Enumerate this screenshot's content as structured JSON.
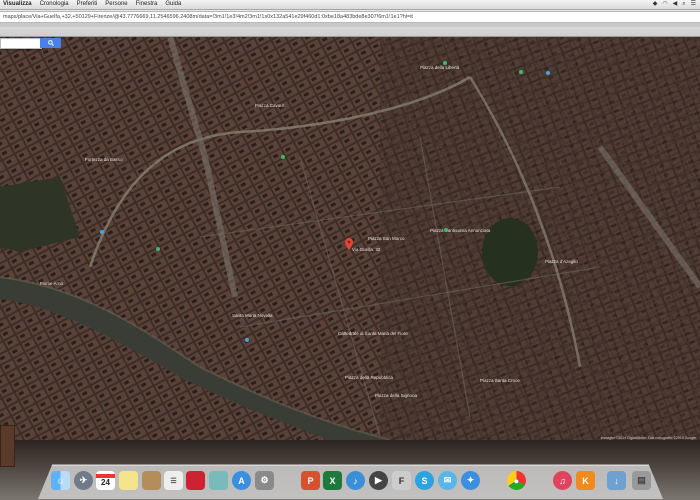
{
  "menubar": {
    "items": [
      "Visualizza",
      "Cronologia",
      "Preferiti",
      "Persone",
      "Finestra",
      "Guida"
    ]
  },
  "toolbar": {
    "url": "maps/place/Via+Guelfa,+32,+50129+Firenze/@43.7776669,11.2546596,2408m/data=!3m1!1e3!4m2!3m1!1s0x132a541e29f460d1:0xbe18a483bde8e307!6m1!1e1?hl=it"
  },
  "map": {
    "labels": [
      "Piazza della Libertà",
      "Via Guelfa, 32",
      "Fortezza da Basso",
      "Piazza Cavour",
      "Santa Maria Novella",
      "Piazza della Repubblica",
      "Piazza San Marco",
      "Piazza Santissima Annunziata",
      "Piazza d'Azeglio",
      "Cattedrale di Santa Maria del Fiore",
      "Piazza della Signoria",
      "Piazza Santa Croce",
      "Fiume Arno"
    ],
    "credit": "Immagini ©2014 DigitalGlobe, Dati cartografici ©2014 Google"
  },
  "dock": {
    "calendar_day": "24",
    "apps": [
      "finder",
      "launchpad",
      "calendar",
      "notes",
      "contacts",
      "reminders",
      "photo-booth",
      "preview",
      "app-store",
      "system-preferences",
      "keynote",
      "excel",
      "itunes",
      "quicktime",
      "chrome",
      "messages",
      "safari",
      "skype",
      "fontbook",
      "firefox",
      "downloads",
      "trash"
    ]
  },
  "colors": {
    "map_base": "#2d2420",
    "river": "#3a3d35",
    "search_button": "#4a80e8",
    "pin": "#e64437"
  }
}
